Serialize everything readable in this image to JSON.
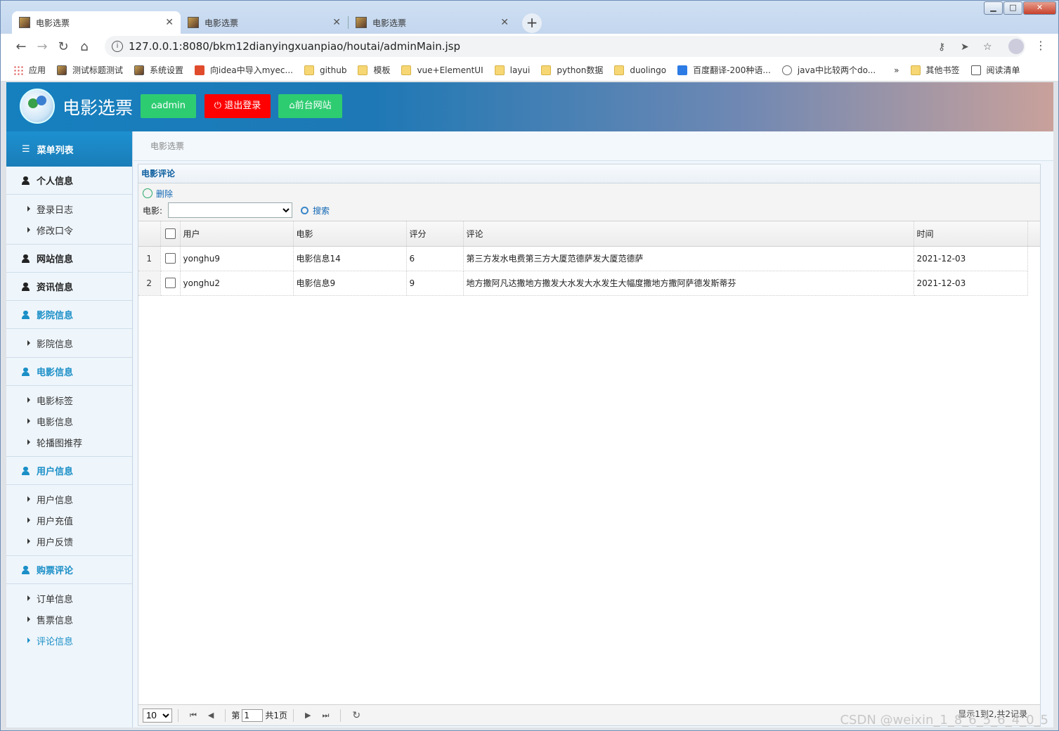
{
  "browser": {
    "tabs": [
      {
        "title": "电影选票"
      },
      {
        "title": "电影选票"
      },
      {
        "title": "电影选票"
      }
    ],
    "new_tab": "+",
    "url": "127.0.0.1:8080/bkm12dianyingxuanpiao/houtai/adminMain.jsp",
    "bookmarks": [
      {
        "label": "应用",
        "icon": "apps-grid-icon"
      },
      {
        "label": "测试标题测试",
        "icon": "image-icon"
      },
      {
        "label": "系统设置",
        "icon": "image-icon"
      },
      {
        "label": "向idea中导入myec...",
        "icon": "c-logo-icon"
      },
      {
        "label": "github",
        "icon": "folder-icon"
      },
      {
        "label": "模板",
        "icon": "folder-icon"
      },
      {
        "label": "vue+ElementUI",
        "icon": "folder-icon"
      },
      {
        "label": "layui",
        "icon": "folder-icon"
      },
      {
        "label": "python数据",
        "icon": "folder-icon"
      },
      {
        "label": "duolingo",
        "icon": "folder-icon"
      },
      {
        "label": "百度翻译-200种语...",
        "icon": "translate-icon"
      },
      {
        "label": "java中比较两个do...",
        "icon": "link-icon"
      }
    ],
    "overflow": "»",
    "other_bookmarks": "其他书签",
    "reading_list": "阅读清单"
  },
  "header": {
    "title": "电影选票",
    "admin_btn": "admin",
    "logout_btn": "退出登录",
    "frontend_btn": "前台网站"
  },
  "sidebar": {
    "head": "菜单列表",
    "groups": [
      {
        "label": "个人信息",
        "items": [
          "登录日志",
          "修改口令"
        ]
      },
      {
        "label": "网站信息",
        "items": []
      },
      {
        "label": "资讯信息",
        "items": []
      },
      {
        "label": "影院信息",
        "items": [
          "影院信息"
        ]
      },
      {
        "label": "电影信息",
        "items": [
          "电影标签",
          "电影信息",
          "轮播图推荐"
        ]
      },
      {
        "label": "用户信息",
        "items": [
          "用户信息",
          "用户充值",
          "用户反馈"
        ]
      },
      {
        "label": "购票评论",
        "items": [
          "订单信息",
          "售票信息",
          "评论信息"
        ]
      }
    ]
  },
  "breadcrumb": "电影选票",
  "panel": {
    "title": "电影评论",
    "delete_label": "删除",
    "movie_filter_label": "电影:",
    "search_label": "搜索",
    "columns": [
      "用户",
      "电影",
      "评分",
      "评论",
      "时间"
    ],
    "rows": [
      {
        "no": "1",
        "user": "yonghu9",
        "movie": "电影信息14",
        "score": "6",
        "comment": "第三方发水电费第三方大厦范德萨发大厦范德萨",
        "time": "2021-12-03"
      },
      {
        "no": "2",
        "user": "yonghu2",
        "movie": "电影信息9",
        "score": "9",
        "comment": "地方撒阿凡达撒地方撒发大水发大水发生大幅度撒地方撒阿萨德发斯蒂芬",
        "time": "2021-12-03"
      }
    ]
  },
  "pager": {
    "page_size": "10",
    "page_prefix": "第",
    "page_value": "1",
    "page_total": "共1页",
    "info": "显示1到2,共2记录"
  },
  "watermark": "CSDN @weixin_1_8_6_5_6_4_0_5",
  "colors": {
    "admin_btn": "#2ecc71",
    "logout_btn": "#ff0000",
    "accent": "#1a8fc7"
  }
}
